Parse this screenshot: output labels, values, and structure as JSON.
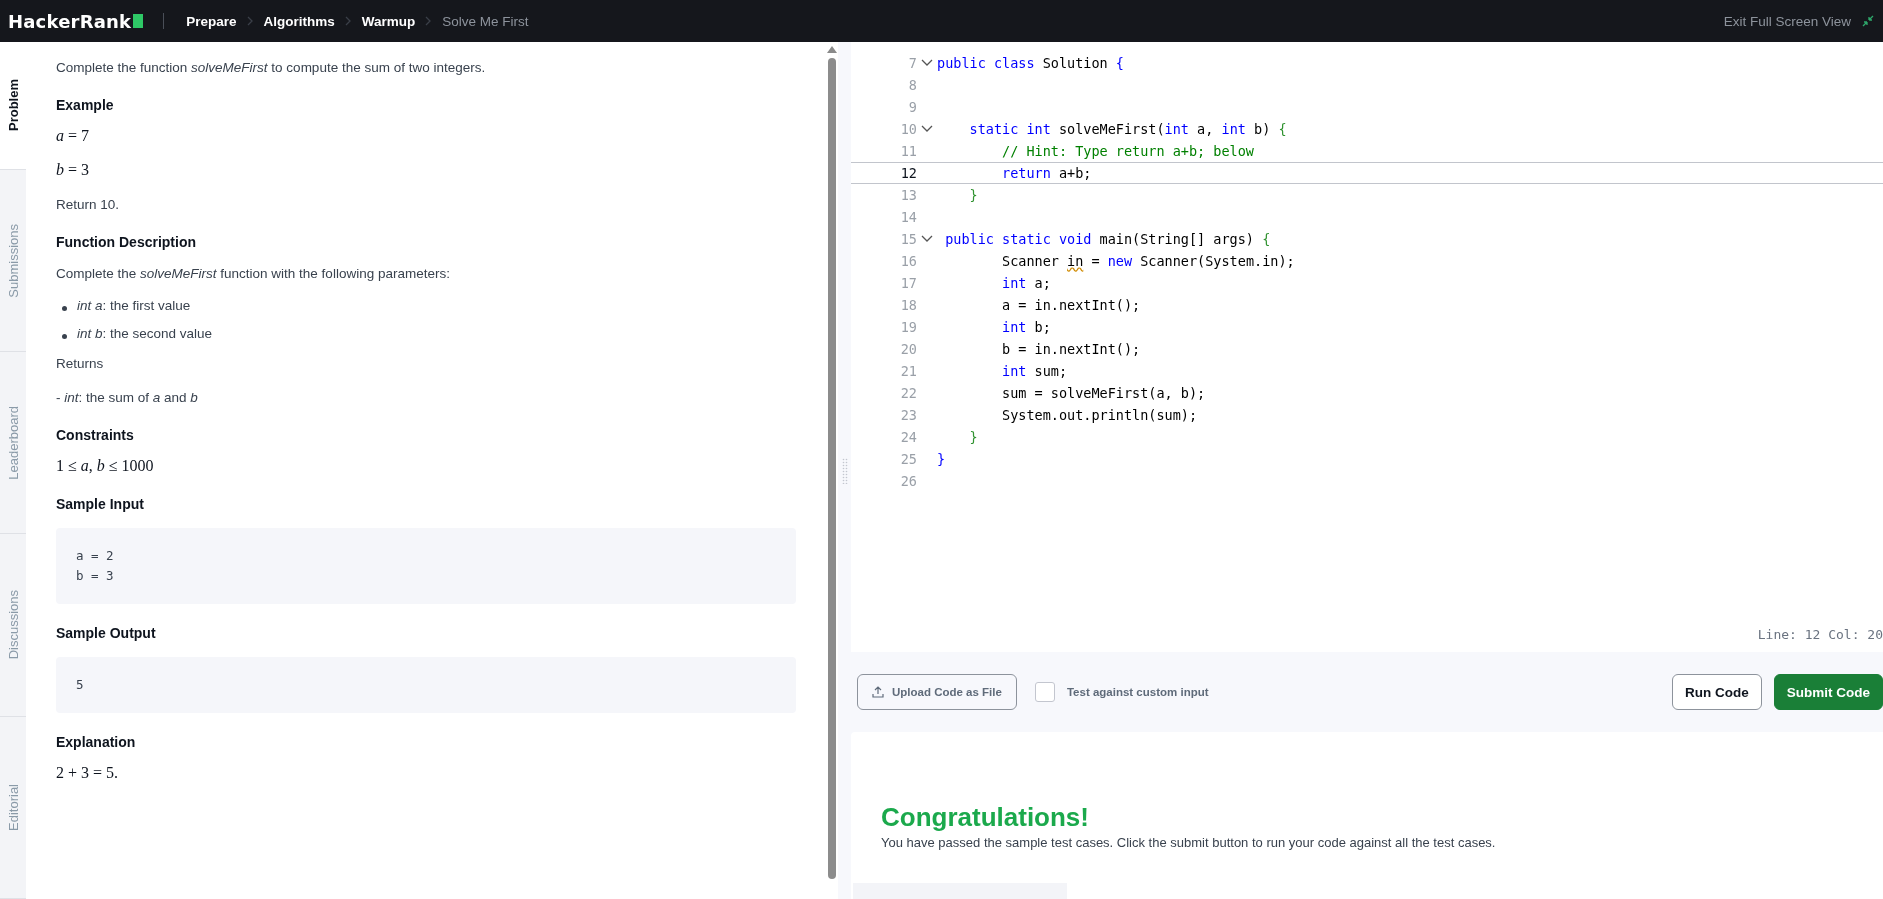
{
  "topbar": {
    "logo": "HackerRank",
    "breadcrumbs": [
      {
        "label": "Prepare",
        "current": false
      },
      {
        "label": "Algorithms",
        "current": false
      },
      {
        "label": "Warmup",
        "current": false
      },
      {
        "label": "Solve Me First",
        "current": true
      }
    ],
    "exit": "Exit Full Screen View"
  },
  "side_tabs": [
    {
      "label": "Problem",
      "selected": true
    },
    {
      "label": "Submissions",
      "selected": false
    },
    {
      "label": "Leaderboard",
      "selected": false
    },
    {
      "label": "Discussions",
      "selected": false
    },
    {
      "label": "Editorial",
      "selected": false
    }
  ],
  "problem": [
    {
      "kind": "text",
      "text": "Complete the function *solveMeFirst* to compute the sum of two integers."
    },
    {
      "kind": "heading",
      "text": "Example"
    },
    {
      "kind": "math",
      "text": "*a* = 7"
    },
    {
      "kind": "math",
      "text": "*b* = 3"
    },
    {
      "kind": "text",
      "text": "Return 10."
    },
    {
      "kind": "heading",
      "text": "Function Description"
    },
    {
      "kind": "text",
      "text": "Complete the *solveMeFirst* function with the following parameters:"
    },
    {
      "kind": "bullet",
      "text": "*int a*: the first value"
    },
    {
      "kind": "bullet",
      "text": "*int b*: the second value"
    },
    {
      "kind": "text",
      "text": "Returns"
    },
    {
      "kind": "text",
      "text": "- *int*: the sum of *a* and *b*"
    },
    {
      "kind": "heading",
      "text": "Constraints"
    },
    {
      "kind": "math",
      "text": "1 ≤ *a*, *b* ≤ 1000"
    },
    {
      "kind": "heading",
      "text": "Sample Input"
    },
    {
      "kind": "code",
      "lines": [
        "a = 2",
        "b = 3"
      ]
    },
    {
      "kind": "heading",
      "text": "Sample Output"
    },
    {
      "kind": "code",
      "lines": [
        "5"
      ]
    },
    {
      "kind": "heading",
      "text": "Explanation"
    },
    {
      "kind": "math",
      "text": "2 + 3 = 5."
    }
  ],
  "editor": {
    "lines": [
      {
        "number": "7",
        "fold": true,
        "current": false,
        "tokens": [
          {
            "text": "public class ",
            "kind": "keyword"
          },
          {
            "text": "Solution ",
            "kind": "plain"
          },
          {
            "text": "{",
            "kind": "outerbrace"
          }
        ]
      },
      {
        "number": "8",
        "fold": false,
        "current": false
      },
      {
        "number": "9",
        "fold": false,
        "current": false
      },
      {
        "number": "10",
        "fold": true,
        "current": false,
        "tokens": [
          {
            "text": "    static int ",
            "kind": "keyword"
          },
          {
            "text": "solveMeFirst(",
            "kind": "plain"
          },
          {
            "text": "int ",
            "kind": "keyword"
          },
          {
            "text": "a, ",
            "kind": "plain"
          },
          {
            "text": "int ",
            "kind": "keyword"
          },
          {
            "text": "b) ",
            "kind": "plain"
          },
          {
            "text": "{",
            "kind": "brace"
          }
        ]
      },
      {
        "number": "11",
        "fold": false,
        "current": false,
        "tokens": [
          {
            "text": "        // Hint: Type return a+b; below",
            "kind": "comment"
          }
        ]
      },
      {
        "number": "12",
        "fold": false,
        "current": true,
        "tokens": [
          {
            "text": "        return ",
            "kind": "keyword"
          },
          {
            "text": "a+b;",
            "kind": "plain"
          }
        ]
      },
      {
        "number": "13",
        "fold": false,
        "current": false,
        "tokens": [
          {
            "text": "    }",
            "kind": "brace"
          }
        ]
      },
      {
        "number": "14",
        "fold": false,
        "current": false
      },
      {
        "number": "15",
        "fold": true,
        "current": false,
        "tokens": [
          {
            "text": " public static void ",
            "kind": "keyword"
          },
          {
            "text": "main(String[] args) ",
            "kind": "plain"
          },
          {
            "text": "{",
            "kind": "brace"
          }
        ]
      },
      {
        "number": "16",
        "fold": false,
        "current": false,
        "tokens": [
          {
            "text": "        Scanner ",
            "kind": "plain"
          },
          {
            "text": "in",
            "kind": "warning"
          },
          {
            "text": " = ",
            "kind": "plain"
          },
          {
            "text": "new ",
            "kind": "keyword"
          },
          {
            "text": "Scanner(System.in);",
            "kind": "plain"
          }
        ]
      },
      {
        "number": "17",
        "fold": false,
        "current": false,
        "tokens": [
          {
            "text": "        int ",
            "kind": "keyword"
          },
          {
            "text": "a;",
            "kind": "plain"
          }
        ]
      },
      {
        "number": "18",
        "fold": false,
        "current": false,
        "tokens": [
          {
            "text": "        a = in.nextInt();",
            "kind": "plain"
          }
        ]
      },
      {
        "number": "19",
        "fold": false,
        "current": false,
        "tokens": [
          {
            "text": "        int ",
            "kind": "keyword"
          },
          {
            "text": "b;",
            "kind": "plain"
          }
        ]
      },
      {
        "number": "20",
        "fold": false,
        "current": false,
        "tokens": [
          {
            "text": "        b = in.nextInt();",
            "kind": "plain"
          }
        ]
      },
      {
        "number": "21",
        "fold": false,
        "current": false,
        "tokens": [
          {
            "text": "        int ",
            "kind": "keyword"
          },
          {
            "text": "sum;",
            "kind": "plain"
          }
        ]
      },
      {
        "number": "22",
        "fold": false,
        "current": false,
        "tokens": [
          {
            "text": "        sum = solveMeFirst(a, b);",
            "kind": "plain"
          }
        ]
      },
      {
        "number": "23",
        "fold": false,
        "current": false,
        "tokens": [
          {
            "text": "        System.out.println(sum);",
            "kind": "plain"
          }
        ]
      },
      {
        "number": "24",
        "fold": false,
        "current": false,
        "tokens": [
          {
            "text": "    }",
            "kind": "brace"
          }
        ]
      },
      {
        "number": "25",
        "fold": false,
        "current": false,
        "tokens": [
          {
            "text": "}",
            "kind": "outerbrace"
          }
        ]
      },
      {
        "number": "26",
        "fold": false,
        "current": false
      }
    ],
    "status": "Line: 12 Col: 20"
  },
  "toolbar": {
    "upload": "Upload Code as File",
    "custom_input": {
      "label": "Test against custom input",
      "checked": false
    },
    "run": "Run Code",
    "submit": "Submit Code"
  },
  "result": {
    "title": "Congratulations!",
    "message": "You have passed the sample test cases. Click the submit button to run your code against all the test cases."
  }
}
